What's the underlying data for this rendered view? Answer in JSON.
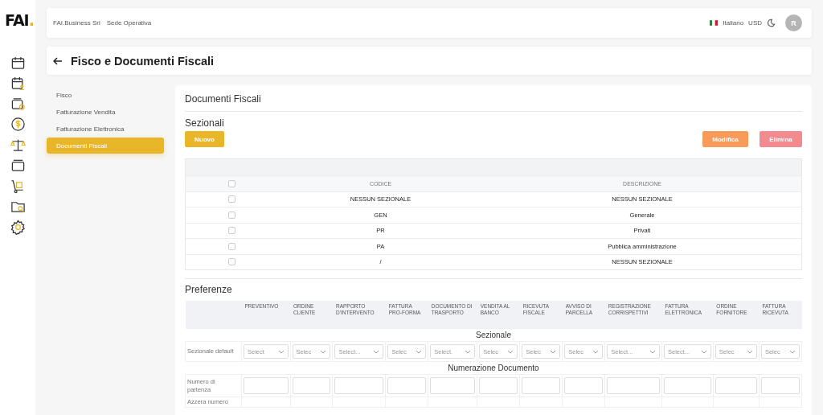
{
  "logo": {
    "text": "FAI",
    "mark": "."
  },
  "header": {
    "company": "FAI.Business Srl",
    "site": "Sede Operativa",
    "language": "Italiano",
    "currency": "USD",
    "avatar": "R"
  },
  "page": {
    "title": "Fisco e Documenti Fiscali"
  },
  "menu": [
    {
      "label": "Fisco",
      "selected": false
    },
    {
      "label": "Fatturazione Vendita",
      "selected": false
    },
    {
      "label": "Fatturazione Elettronica",
      "selected": false
    },
    {
      "label": "Documenti Fiscali",
      "selected": true
    }
  ],
  "panel": {
    "title": "Documenti Fiscali",
    "sezionali": {
      "title": "Sezionali",
      "buttons": [
        {
          "label": "Nuovo",
          "kind": "primary"
        },
        {
          "label": "Modifica",
          "kind": "edit"
        },
        {
          "label": "Elimina",
          "kind": "delete"
        }
      ],
      "table": {
        "select_all_checked": false,
        "columns": [
          "CODICE",
          "DESCRIZIONE"
        ],
        "rows": [
          {
            "checked": false,
            "codice": "NESSUN SEZIONALE",
            "descrizione": "NESSUN SEZIONALE"
          },
          {
            "checked": false,
            "codice": "GEN",
            "descrizione": "Generale"
          },
          {
            "checked": false,
            "codice": "PR",
            "descrizione": "Privati"
          },
          {
            "checked": false,
            "codice": "PA",
            "descrizione": "Pubblica amministrazione"
          },
          {
            "checked": false,
            "codice": "/",
            "descrizione": "NESSUN SEZIONALE"
          }
        ]
      }
    },
    "preferenze": {
      "title": "Preferenze",
      "columns": [
        "PREVENTIVO",
        "ORDINE CLIENTE",
        "RAPPORTO D'INTERVENTO",
        "FATTURA PRO-FORMA",
        "DOCUMENTO DI TRASPORTO",
        "VENDITA AL BANCO",
        "RICEVUTA FISCALE",
        "AVVISO DI PARCELLA",
        "REGISTRAZIONE CORRISPETTIVI",
        "FATTURA ELETTRONICA",
        "ORDINE FORNITORE",
        "FATTURA RICEVUTA"
      ],
      "sections": [
        {
          "title": "Sezionale",
          "rows": [
            {
              "label": "Sezionale default",
              "kind": "select",
              "cells": [
                "Select",
                "Selec",
                "Select...",
                "Selec",
                "Select.",
                "Selec",
                "Selec",
                "Selec",
                "Select...",
                "Select...",
                "Selec",
                "Selec"
              ]
            }
          ]
        },
        {
          "title": "Numerazione Documento",
          "rows": [
            {
              "label": "Numero di partenza",
              "kind": "input"
            },
            {
              "label": "Azzera numero",
              "kind": "blank"
            }
          ]
        }
      ]
    }
  }
}
